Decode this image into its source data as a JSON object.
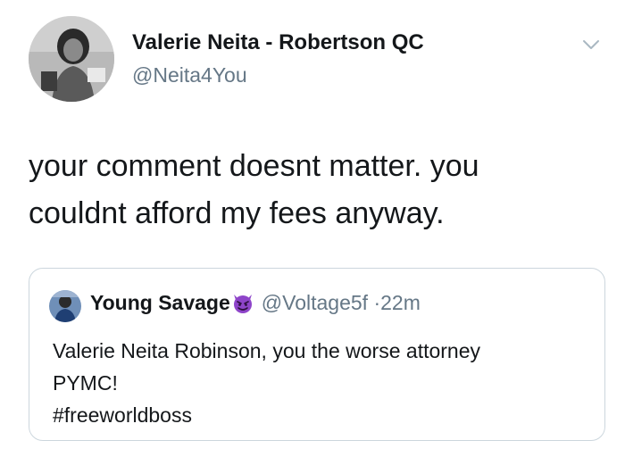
{
  "tweet": {
    "author_name": "Valerie Neita - Robertson QC",
    "author_handle": "@Neita4You",
    "text_line1": "your comment doesnt matter. you",
    "text_line2": "couldnt afford my fees anyway."
  },
  "quoted": {
    "author_name": "Young Savage",
    "emoji": "smiling-imp-emoji",
    "author_handle": "@Voltage5f",
    "separator": "·",
    "time": "22m",
    "text_line1": "Valerie Neita Robinson, you the worse attorney",
    "text_line2": "PYMC!",
    "text_line3": "#freeworldboss"
  },
  "icons": {
    "menu": "chevron-down-icon",
    "avatar": "user-avatar-photo",
    "quoted_avatar": "user-avatar-photo"
  },
  "colors": {
    "primary_text": "#14171a",
    "secondary_text": "#657786",
    "border": "#ccd6dd",
    "emoji": "#8e44c9"
  }
}
